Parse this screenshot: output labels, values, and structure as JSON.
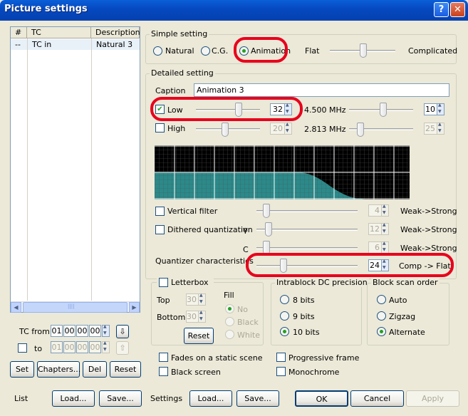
{
  "window": {
    "title": "Picture settings",
    "help": "?",
    "close": "✕"
  },
  "list": {
    "headers": [
      "#",
      "TC",
      "Description"
    ],
    "row": {
      "num": "--",
      "tc": "TC in",
      "desc": "Natural 3"
    },
    "scroll_left": "◀",
    "scroll_right": "▶",
    "scroll_grip": "||||"
  },
  "tc": {
    "from_label": "TC from",
    "to_label": "to",
    "from": [
      "01",
      "00",
      "00",
      "00"
    ],
    "to": [
      "01",
      "00",
      "00",
      "00"
    ],
    "down_btn": "⇩",
    "up_btn": "⇧"
  },
  "list_buttons": {
    "set": "Set",
    "chapters": "Chapters...",
    "del": "Del",
    "reset": "Reset"
  },
  "simple": {
    "title": "Simple setting",
    "natural": "Natural",
    "cg": "C.G.",
    "animation": "Animation",
    "selected": "Animation",
    "flat": "Flat",
    "complicated": "Complicated",
    "level": 0.5
  },
  "detailed": {
    "title": "Detailed setting",
    "caption_label": "Caption",
    "caption_value": "Animation 3",
    "low": {
      "label": "Low",
      "checked": true,
      "value": "32",
      "freq": "4.500 MHz",
      "freq_value": "10"
    },
    "high": {
      "label": "High",
      "checked": false,
      "value": "20",
      "freq": "2.813 MHz",
      "freq_value": "25"
    },
    "vfilter": {
      "label": "Vertical filter",
      "value": "4",
      "range": "Weak->Strong"
    },
    "dither": {
      "label": "Dithered quantization",
      "y": "Y",
      "c": "C",
      "y_value": "12",
      "c_value": "6",
      "range": "Weak->Strong"
    },
    "quant": {
      "label": "Quantizer characteristics",
      "value": "24",
      "range": "Comp -> Flat"
    }
  },
  "letterbox": {
    "label": "Letterbox",
    "top": "Top",
    "bottom": "Bottom",
    "top_value": "30",
    "bottom_value": "30",
    "fill": "Fill",
    "no": "No",
    "black": "Black",
    "white": "White",
    "reset": "Reset"
  },
  "dc": {
    "title": "Intrablock DC precision",
    "o8": "8 bits",
    "o9": "9 bits",
    "o10": "10 bits",
    "selected": "10 bits"
  },
  "scan": {
    "title": "Block scan order",
    "auto": "Auto",
    "zigzag": "Zigzag",
    "alternate": "Alternate",
    "selected": "Alternate"
  },
  "options": {
    "fades": "Fades on a static scene",
    "black_screen": "Black screen",
    "progressive": "Progressive frame",
    "mono": "Monochrome"
  },
  "bottom": {
    "list": "List",
    "load": "Load...",
    "save": "Save...",
    "settings": "Settings",
    "ok": "OK",
    "cancel": "Cancel",
    "apply": "Apply"
  },
  "colors": {
    "highlight": "#e8001c",
    "graph_fill": "#2a8a8a",
    "graph_bg": "#000000"
  }
}
